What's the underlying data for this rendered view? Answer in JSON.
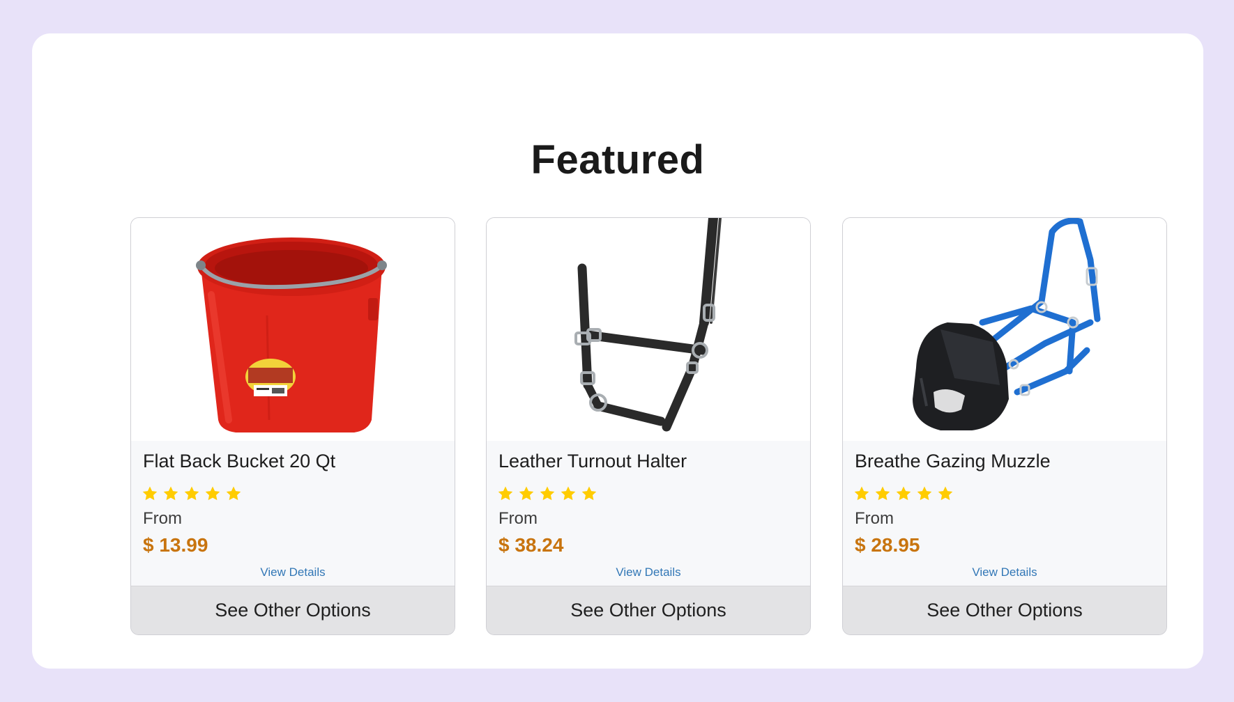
{
  "section": {
    "title": "Featured"
  },
  "colors": {
    "background": "#e8e2f9",
    "star": "#ffcc00",
    "price": "#c8740e",
    "link": "#3277b6"
  },
  "products": [
    {
      "name": "Flat Back Bucket 20 Qt",
      "rating": 5,
      "from_label": "From",
      "price": "$ 13.99",
      "details_label": "View Details",
      "options_label": "See Other Options",
      "image_icon": "red-bucket-image"
    },
    {
      "name": "Leather Turnout Halter",
      "rating": 5,
      "from_label": "From",
      "price": "$ 38.24",
      "details_label": "View Details",
      "options_label": "See Other Options",
      "image_icon": "leather-halter-image"
    },
    {
      "name": "Breathe Gazing Muzzle",
      "rating": 5,
      "from_label": "From",
      "price": "$ 28.95",
      "details_label": "View Details",
      "options_label": "See Other Options",
      "image_icon": "blue-muzzle-halter-image"
    }
  ]
}
